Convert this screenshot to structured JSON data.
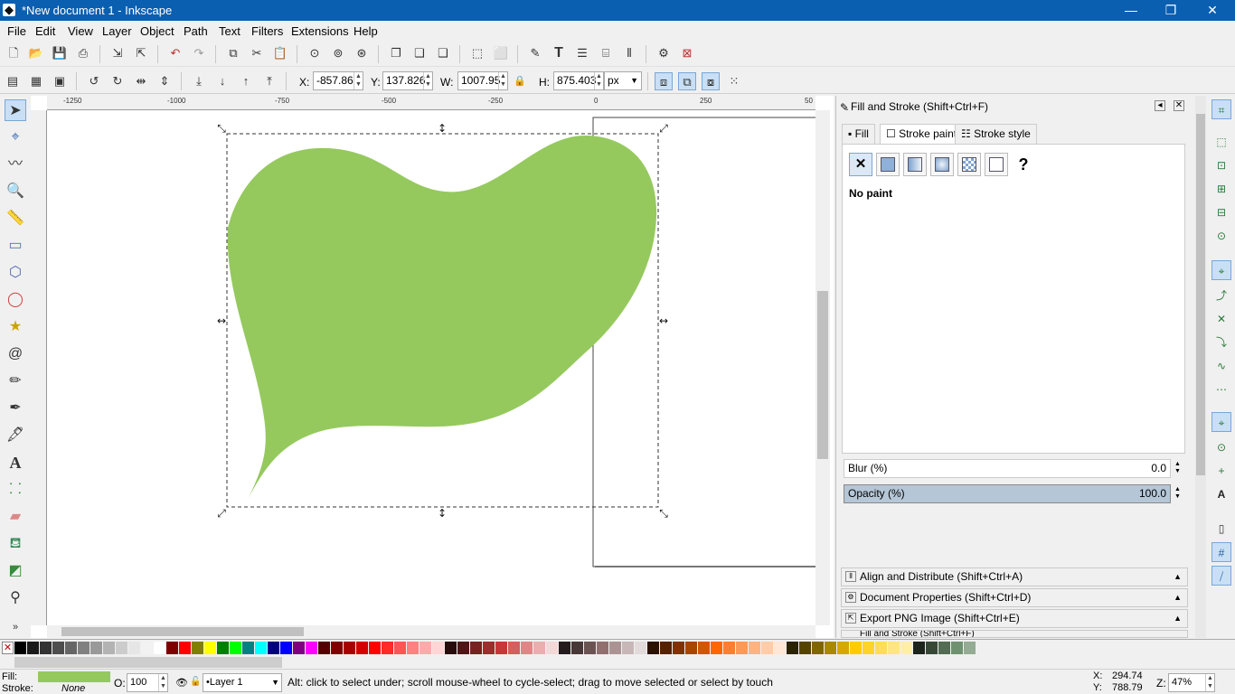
{
  "window": {
    "title": "*New document 1 - Inkscape",
    "minimize": "—",
    "maximize": "❐",
    "close": "✕"
  },
  "menu": [
    "File",
    "Edit",
    "View",
    "Layer",
    "Object",
    "Path",
    "Text",
    "Filters",
    "Extensions",
    "Help"
  ],
  "controls": {
    "x_label": "X:",
    "x_value": "-857.86",
    "y_label": "Y:",
    "y_value": "137.826",
    "w_label": "W:",
    "w_value": "1007.95",
    "h_label": "H:",
    "h_value": "875.403",
    "unit": "px"
  },
  "ruler": {
    "h_ticks": [
      "-1250",
      "-1000",
      "-750",
      "-500",
      "-250",
      "0",
      "250",
      "50"
    ]
  },
  "shape": {
    "fill": "#95c95e"
  },
  "dock": {
    "title": "Fill and Stroke (Shift+Ctrl+F)",
    "tabs": [
      "Fill",
      "Stroke paint",
      "Stroke style"
    ],
    "paint_status": "No paint",
    "blur_label": "Blur (%)",
    "blur_value": "0.0",
    "opacity_label": "Opacity (%)",
    "opacity_value": "100.0",
    "collapsed": [
      "Align and Distribute (Shift+Ctrl+A)",
      "Document Properties (Shift+Ctrl+D)",
      "Export PNG Image (Shift+Ctrl+E)",
      "Fill and Stroke (Shift+Ctrl+F)"
    ]
  },
  "status": {
    "fill_label": "Fill:",
    "stroke_label": "Stroke:",
    "stroke_value": "None",
    "fill_color": "#95c95e",
    "opacity_label": "O:",
    "opacity_value": "100",
    "layer": "•Layer 1",
    "message": "Alt: click to select under; scroll mouse-wheel to cycle-select; drag to move selected or select by touch",
    "cursor_x_label": "X:",
    "cursor_x": "294.74",
    "cursor_y_label": "Y:",
    "cursor_y": "788.79",
    "zoom_label": "Z:",
    "zoom": "47%"
  },
  "colors": {
    "accent": "#0a5fb0",
    "selection": "#c8dff5"
  }
}
